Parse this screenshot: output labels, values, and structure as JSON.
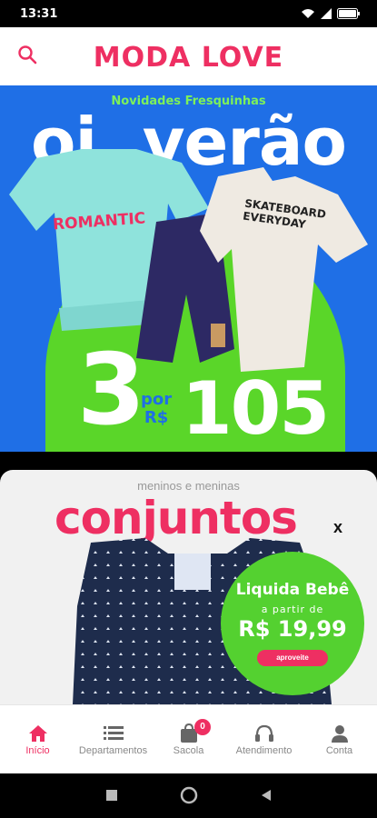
{
  "status": {
    "time": "13:31"
  },
  "header": {
    "brand": "MODA LOVE"
  },
  "banner1": {
    "subtitle": "Novidades Fresquinhas",
    "title": "oi, verão",
    "tee_left_text": "ROMANTIC",
    "tee_right_text": "SKATEBOARD EVERYDAY",
    "price_qty": "3",
    "price_por": "por",
    "price_currency": "R$",
    "price_value": "105"
  },
  "banner2": {
    "kicker": "meninos e meninas",
    "headline": "conjuntos",
    "close": "x",
    "promo_title": "Liquida Bebê",
    "promo_sub": "a partir de",
    "promo_price": "R$ 19,99",
    "promo_button": "aproveite"
  },
  "bottom_nav": {
    "items": [
      {
        "label": "Início",
        "icon": "home-icon"
      },
      {
        "label": "Departamentos",
        "icon": "list-icon"
      },
      {
        "label": "Sacola",
        "icon": "bag-icon",
        "badge": "0"
      },
      {
        "label": "Atendimento",
        "icon": "headset-icon"
      },
      {
        "label": "Conta",
        "icon": "user-icon"
      }
    ]
  },
  "colors": {
    "brand": "#ee2f62",
    "banner_blue": "#1f6fe6",
    "banner_green": "#5ad629"
  }
}
